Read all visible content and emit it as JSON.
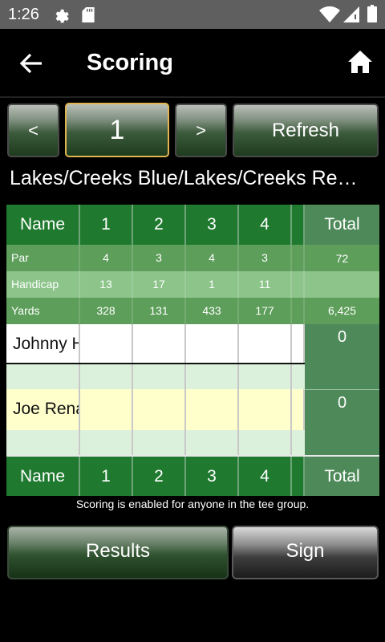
{
  "status_bar": {
    "time": "1:26"
  },
  "app_bar": {
    "title": "Scoring"
  },
  "nav": {
    "prev_label": "<",
    "hole_number": "1",
    "next_label": ">",
    "refresh_label": "Refresh"
  },
  "course_name": "Lakes/Creeks Blue/Lakes/Creeks Re…",
  "scorecard": {
    "header": {
      "name_label": "Name",
      "holes": [
        "1",
        "2",
        "3",
        "4"
      ],
      "total_label": "Total"
    },
    "par": {
      "label": "Par",
      "values": [
        "4",
        "3",
        "4",
        "3"
      ],
      "total": "72"
    },
    "handicap": {
      "label": "Handicap",
      "values": [
        "13",
        "17",
        "1",
        "11"
      ]
    },
    "yards": {
      "label": "Yards",
      "values": [
        "328",
        "131",
        "433",
        "177"
      ],
      "total": "6,425"
    },
    "players": [
      {
        "name": "Johnny H",
        "total": "0"
      },
      {
        "name": "Joe Rena",
        "total": "0"
      }
    ],
    "footer": {
      "name_label": "Name",
      "holes": [
        "1",
        "2",
        "3",
        "4"
      ],
      "total_label": "Total"
    }
  },
  "note": "Scoring is enabled for anyone in the tee group.",
  "actions": {
    "results_label": "Results",
    "sign_label": "Sign"
  },
  "colors": {
    "header_green": "#1f7a2f",
    "par_green": "#5d9e5a",
    "handicap_green": "#8cc48a",
    "total_green": "#4e8a59",
    "player2_yellow": "#ffffcc",
    "strip_green": "#dcf1dc",
    "selected_border": "#e0b451"
  }
}
